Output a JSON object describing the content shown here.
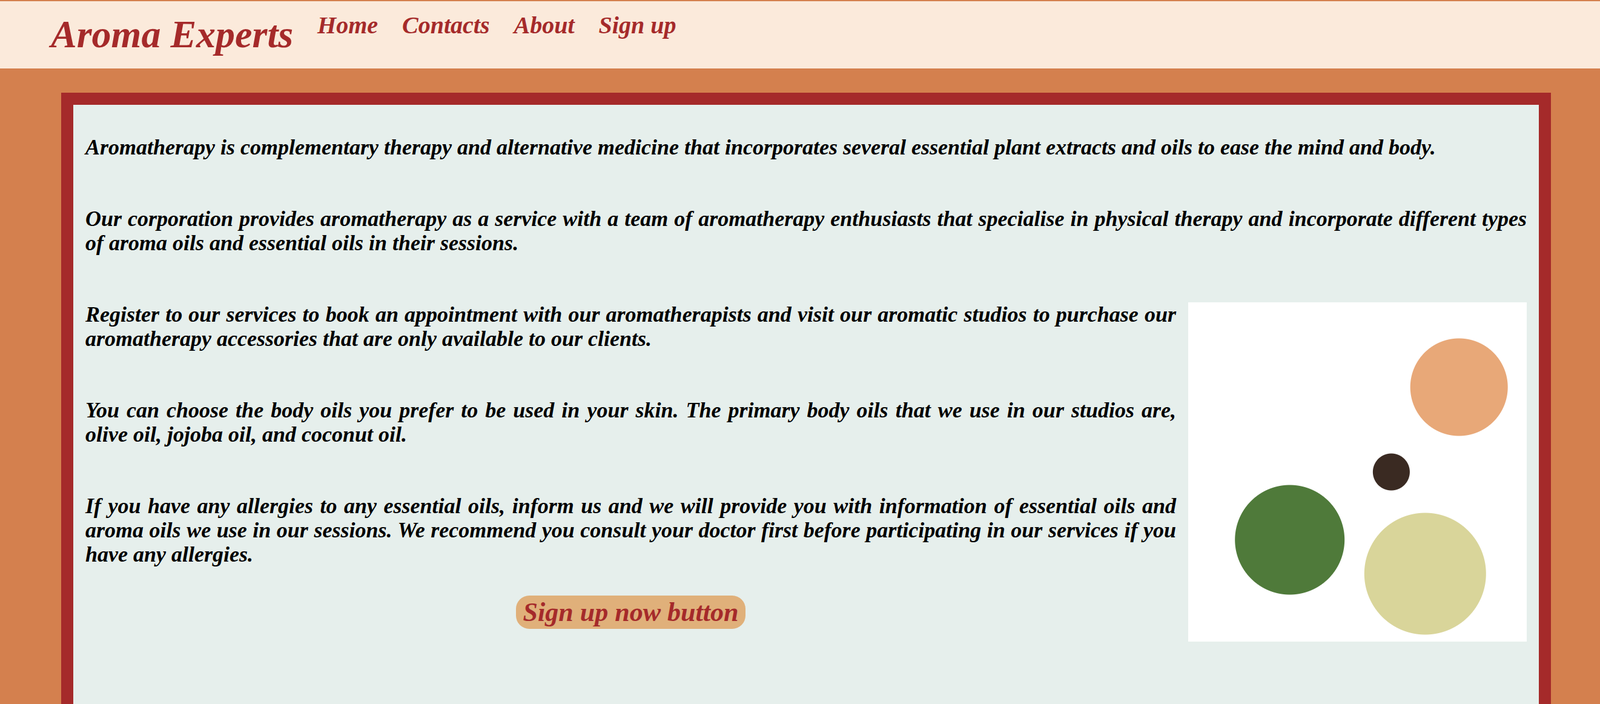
{
  "header": {
    "logo": "Aroma Experts",
    "nav": [
      "Home",
      "Contacts",
      "About",
      "Sign up"
    ]
  },
  "paragraphs": [
    "Aromatherapy is complementary therapy and alternative medicine that incorporates several essential plant extracts and oils to ease the mind and body.",
    "Our corporation provides aromatherapy as a service with a team of aromatherapy enthusiasts that specialise in physical therapy and incorporate different types of aroma oils and essential oils in their sessions.",
    "Register to our services to book an appointment with our aromatherapists and visit our aromatic studios to purchase our aromatherapy accessories that are only available to our clients.",
    "You can choose the body oils you prefer to be used in your skin. The primary body oils that we use in our studios are, olive oil, jojoba oil, and coconut oil.",
    "If you have any allergies to any essential oils, inform us and we will provide you with information of essential oils and aroma oils we use in our sessions. We recommend you consult your doctor first before participating in our services if you have any allergies."
  ],
  "button": "Sign up now button"
}
